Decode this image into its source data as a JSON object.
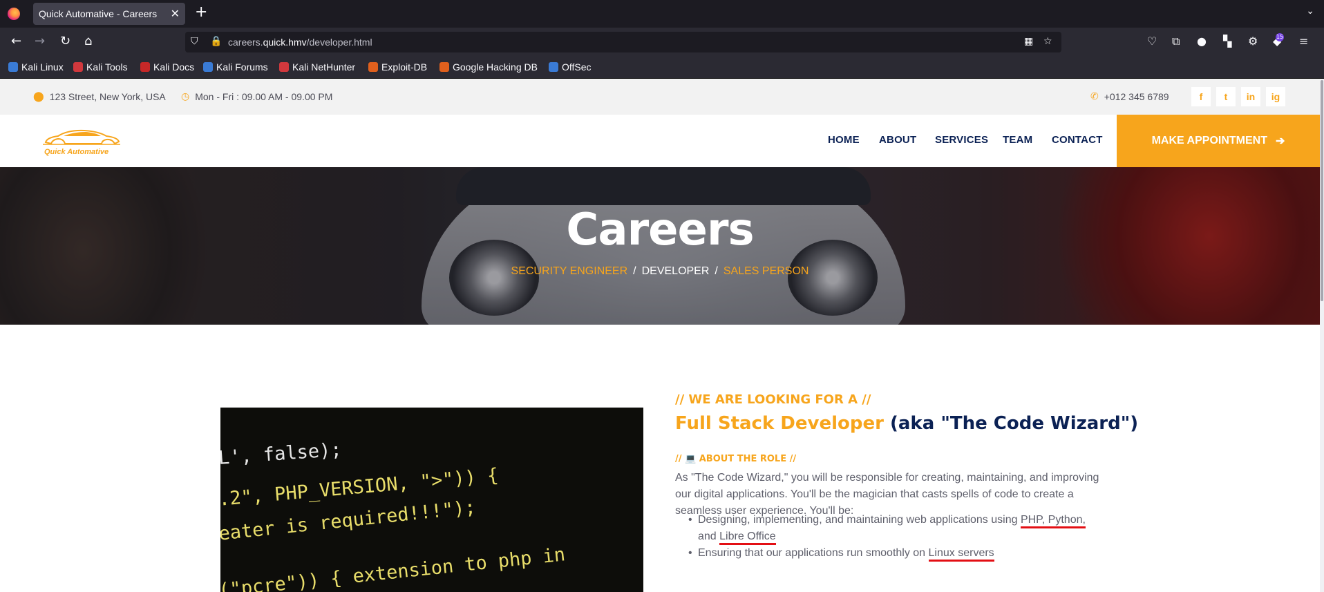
{
  "browser": {
    "tab_title": "Quick Automative - Careers",
    "url_host_prefix": "careers.",
    "url_host_main": "quick.hmv",
    "url_path": "/developer.html",
    "extension_badge": "15",
    "bookmarks": [
      {
        "label": "Kali Linux",
        "color": "#3a7bd5"
      },
      {
        "label": "Kali Tools",
        "color": "#d1383d"
      },
      {
        "label": "Kali Docs",
        "color": "#c62828"
      },
      {
        "label": "Kali Forums",
        "color": "#3a7bd5"
      },
      {
        "label": "Kali NetHunter",
        "color": "#d1383d"
      },
      {
        "label": "Exploit-DB",
        "color": "#e0601d"
      },
      {
        "label": "Google Hacking DB",
        "color": "#e0601d"
      },
      {
        "label": "OffSec",
        "color": "#3a7bd5"
      }
    ]
  },
  "topbar": {
    "address": "123 Street, New York, USA",
    "hours": "Mon - Fri : 09.00 AM - 09.00 PM",
    "phone": "+012 345 6789",
    "socials": [
      "f",
      "t",
      "in",
      "ig"
    ]
  },
  "header": {
    "logo_text": "Quick Automative",
    "menu": [
      "HOME",
      "ABOUT",
      "SERVICES",
      "TEAM",
      "CONTACT"
    ],
    "cta": "MAKE APPOINTMENT"
  },
  "hero": {
    "title": "Careers",
    "crumbs": [
      {
        "label": "SECURITY ENGINEER",
        "active": false
      },
      {
        "label": "DEVELOPER",
        "active": true
      },
      {
        "label": "SALES PERSON",
        "active": false
      }
    ]
  },
  "job": {
    "kicker": "// WE ARE LOOKING FOR A //",
    "title_highlight": "Full Stack Developer",
    "title_rest": " (aka \"The Code Wizard\")",
    "role_kicker": "// 💻 ABOUT THE ROLE //",
    "intro": "As \"The Code Wizard,\" you will be responsible for creating, maintaining, and improving our digital applications. You'll be the magician that casts spells of code to create a seamless user experience. You'll be:",
    "bullet1_pre": "Designing, implementing, and maintaining web applications using ",
    "bullet1_tech": "PHP, Python,",
    "bullet1_and": "and ",
    "bullet1_tech2": "Libre Office",
    "bullet2_pre": "Ensuring that our applications run smoothly on ",
    "bullet2_tech": "Linux servers"
  },
  "code_image": {
    "line1": "L', false);",
    "line2": ".2\", PHP_VERSION, \">\")) {",
    "line3": "eater is required!!!\");",
    "line4": "(\"pcre\")) {        extension to php in"
  },
  "colors": {
    "accent": "#f7a51c",
    "navy": "#0b2154",
    "underline_red": "#e30f14"
  }
}
